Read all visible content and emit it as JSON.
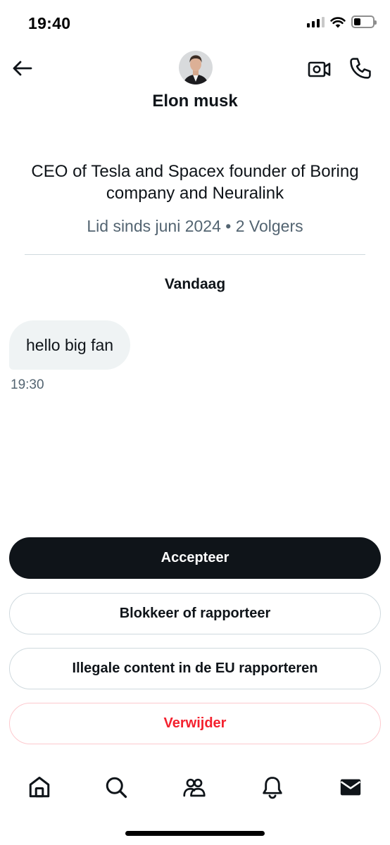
{
  "status_bar": {
    "time": "19:40",
    "icons": [
      "cellular-signal-icon",
      "wifi-icon",
      "battery-icon"
    ],
    "battery_level": 0.25
  },
  "header": {
    "back_icon": "arrow-left-icon",
    "name": "Elon musk",
    "actions": [
      "video-call-icon",
      "phone-call-icon"
    ]
  },
  "profile": {
    "bio": "CEO of Tesla and Spacex founder of Boring company and Neuralink",
    "meta": "Lid sinds juni 2024 • 2 Volgers"
  },
  "conversation": {
    "date_label": "Vandaag",
    "messages": [
      {
        "text": "hello big fan",
        "time": "19:30"
      }
    ]
  },
  "actions": {
    "accept": "Accepteer",
    "block_report": "Blokkeer of rapporteer",
    "illegal_content": "Illegale content in de EU rapporteren",
    "delete": "Verwijder"
  },
  "bottom_nav": {
    "items": [
      "home-icon",
      "search-icon",
      "communities-icon",
      "notifications-icon",
      "messages-icon"
    ],
    "active": "messages-icon"
  },
  "colors": {
    "text_primary": "#0f1419",
    "text_secondary": "#536471",
    "accept_bg": "#0f1419",
    "bubble_bg": "#eff3f4",
    "delete_red": "#f4212e",
    "border": "#cfd9de"
  }
}
